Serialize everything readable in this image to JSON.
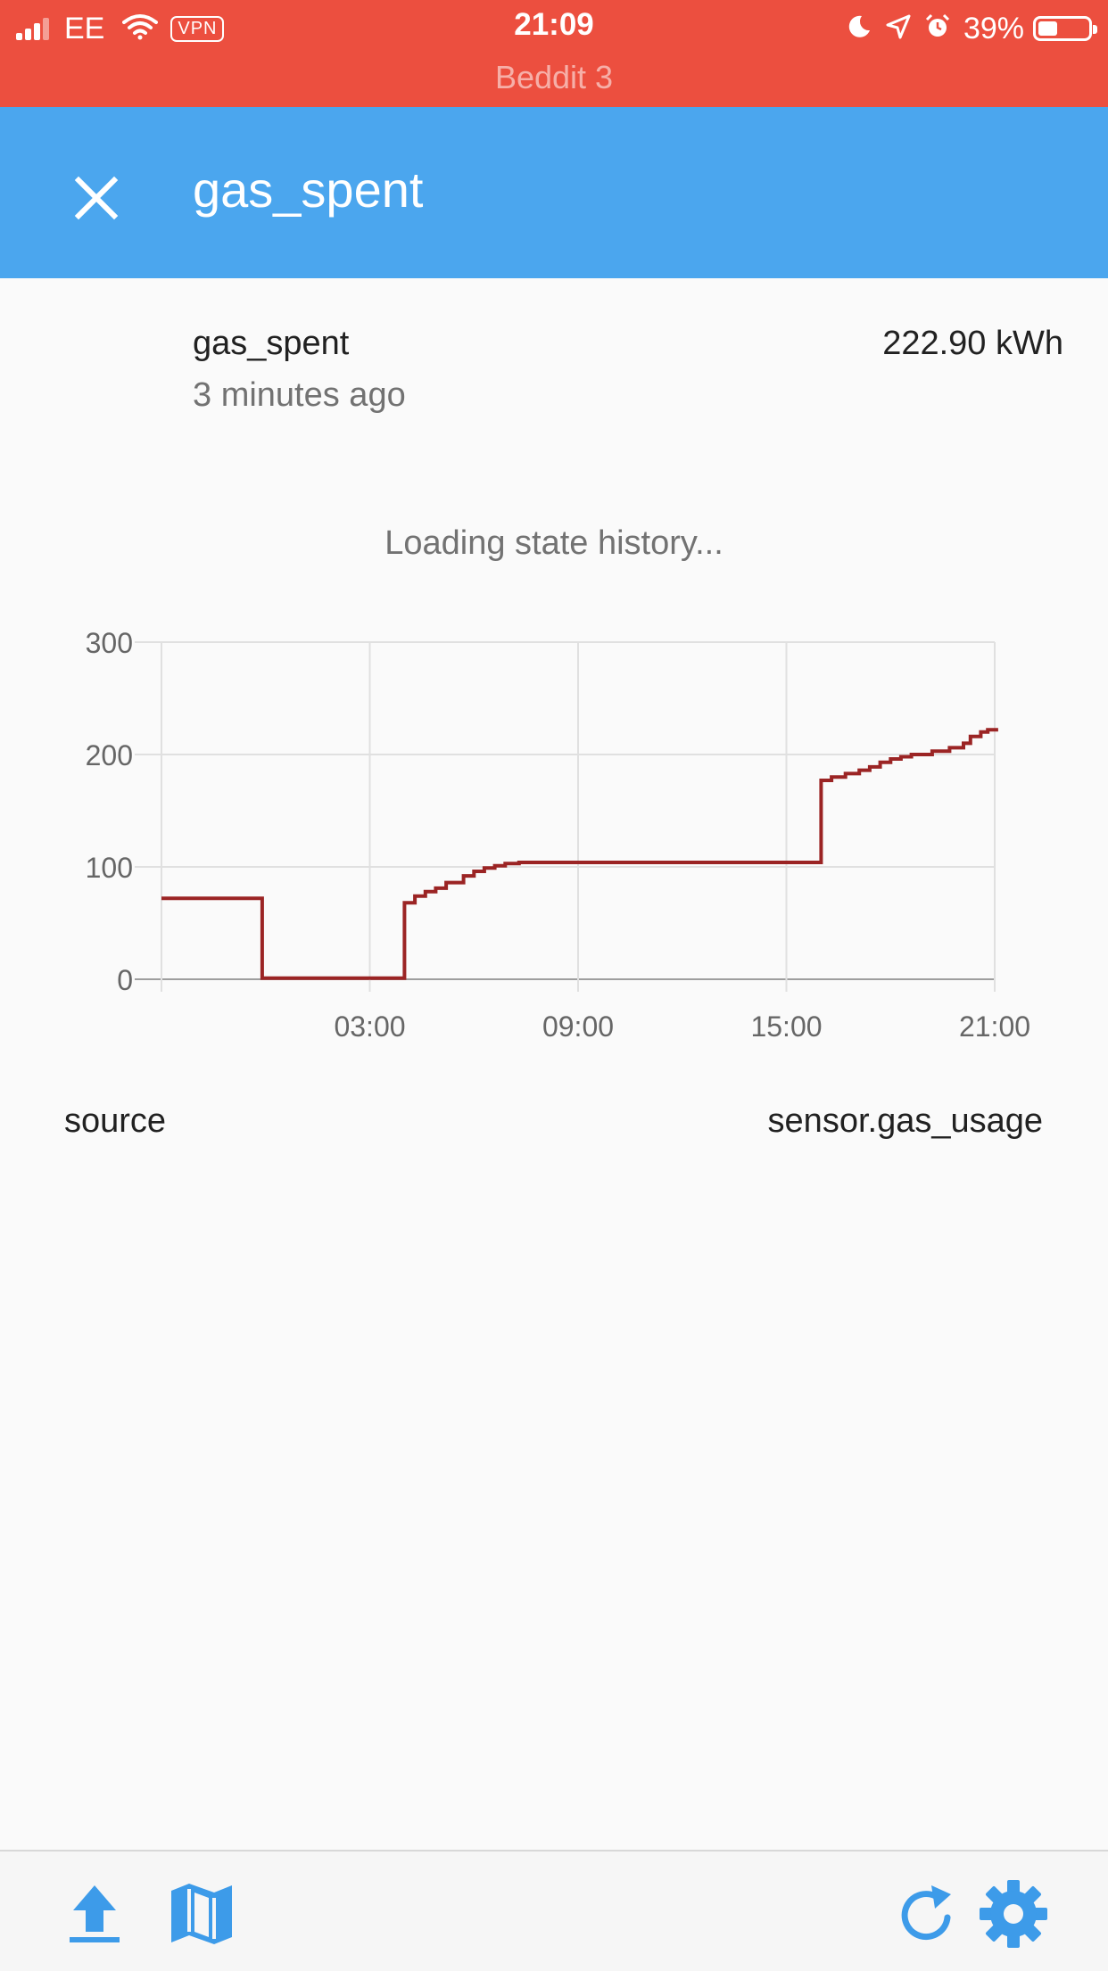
{
  "status_bar": {
    "carrier": "EE",
    "vpn": "VPN",
    "time": "21:09",
    "battery_percent": "39%",
    "battery_level": 0.39,
    "back_app": "Beddit 3"
  },
  "header": {
    "title": "gas_spent"
  },
  "state": {
    "name": "gas_spent",
    "last_changed": "3 minutes ago",
    "value": "222.90 kWh"
  },
  "loading_text": "Loading state history...",
  "chart_data": {
    "type": "line",
    "step": true,
    "color": "#9b2424",
    "xlim": [
      -3,
      21
    ],
    "ylim": [
      0,
      300
    ],
    "y_ticks": [
      "300",
      "200",
      "100",
      "0"
    ],
    "y_tick_values": [
      300,
      200,
      100,
      0
    ],
    "x_ticks": [
      "03:00",
      "09:00",
      "15:00",
      "21:00"
    ],
    "x_tick_values": [
      3,
      9,
      15,
      21
    ],
    "grid": true,
    "series": [
      {
        "points": [
          [
            -3,
            72
          ],
          [
            -0.1,
            72
          ],
          [
            -0.1,
            1
          ],
          [
            4.0,
            1
          ],
          [
            4.0,
            68
          ],
          [
            4.3,
            68
          ],
          [
            4.3,
            74
          ],
          [
            4.6,
            74
          ],
          [
            4.6,
            78
          ],
          [
            4.9,
            78
          ],
          [
            4.9,
            81
          ],
          [
            5.2,
            81
          ],
          [
            5.2,
            86
          ],
          [
            5.7,
            86
          ],
          [
            5.7,
            92
          ],
          [
            6.0,
            92
          ],
          [
            6.0,
            96
          ],
          [
            6.3,
            96
          ],
          [
            6.3,
            99
          ],
          [
            6.6,
            99
          ],
          [
            6.6,
            101
          ],
          [
            6.9,
            101
          ],
          [
            6.9,
            103
          ],
          [
            7.3,
            103
          ],
          [
            7.3,
            104
          ],
          [
            16.0,
            104
          ],
          [
            16.0,
            177
          ],
          [
            16.3,
            177
          ],
          [
            16.3,
            180
          ],
          [
            16.7,
            180
          ],
          [
            16.7,
            183
          ],
          [
            17.1,
            183
          ],
          [
            17.1,
            186
          ],
          [
            17.4,
            186
          ],
          [
            17.4,
            189
          ],
          [
            17.7,
            189
          ],
          [
            17.7,
            193
          ],
          [
            18.0,
            193
          ],
          [
            18.0,
            196
          ],
          [
            18.3,
            196
          ],
          [
            18.3,
            198
          ],
          [
            18.6,
            198
          ],
          [
            18.6,
            200
          ],
          [
            19.2,
            200
          ],
          [
            19.2,
            203
          ],
          [
            19.7,
            203
          ],
          [
            19.7,
            206
          ],
          [
            20.1,
            206
          ],
          [
            20.1,
            210
          ],
          [
            20.3,
            210
          ],
          [
            20.3,
            216
          ],
          [
            20.6,
            216
          ],
          [
            20.6,
            220
          ],
          [
            20.8,
            220
          ],
          [
            20.8,
            222
          ],
          [
            21.1,
            222
          ]
        ]
      }
    ]
  },
  "attributes": [
    {
      "key": "source",
      "value": "sensor.gas_usage"
    }
  ],
  "toolbar": {
    "left_icons": [
      "upload-icon",
      "map-icon"
    ],
    "right_icons": [
      "refresh-icon",
      "settings-icon"
    ],
    "color": "#3d9be9"
  }
}
